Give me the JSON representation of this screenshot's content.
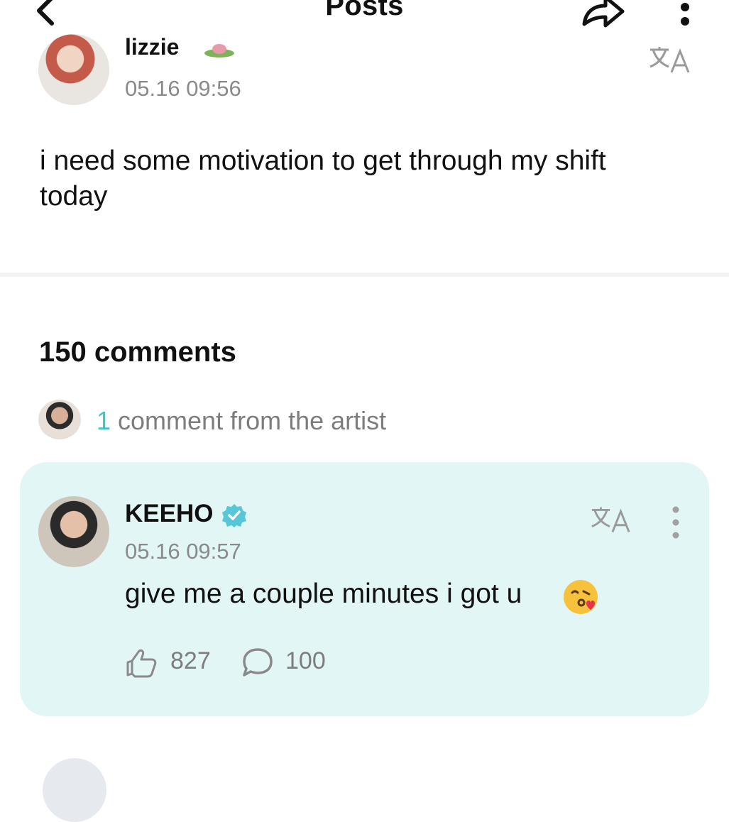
{
  "header": {
    "title": "Posts",
    "icons": [
      "chevron-left-icon",
      "share-icon",
      "more-vertical-icon"
    ]
  },
  "post": {
    "author": "lizzie",
    "date": "05.16 09:56",
    "body": "i need some motivation to get through my shift today"
  },
  "comments": {
    "count_label": "150 comments",
    "artist_summary": {
      "number": "1",
      "text": " comment from the artist"
    }
  },
  "highlighted_comment": {
    "author": "KEEHO",
    "date": "05.16 09:57",
    "body": "give me a couple minutes i got u",
    "likes": "827",
    "replies": "100",
    "background": "#e2f6f5",
    "accent": "#40c3c9"
  }
}
